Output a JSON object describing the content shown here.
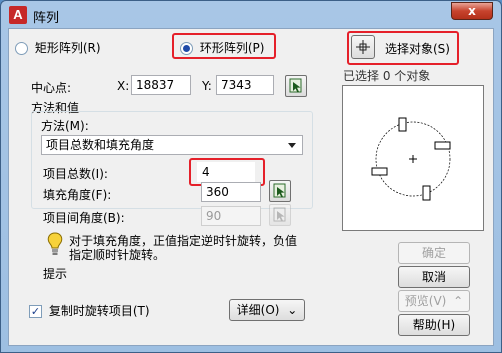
{
  "window": {
    "title": "阵列",
    "app_icon_letter": "A",
    "close_glyph": "x"
  },
  "array_type": {
    "rectangular_label": "矩形阵列(R)",
    "polar_label": "环形阵列(P)",
    "selected": "polar"
  },
  "select_objects": {
    "label": "选择对象(S)",
    "status": "已选择 0 个对象"
  },
  "center_point": {
    "label": "中心点:",
    "x_label": "X:",
    "x_value": "18837",
    "y_label": "Y:",
    "y_value": "7343"
  },
  "method_group": {
    "title": "方法和值",
    "method_label": "方法(M):",
    "method_value": "项目总数和填充角度",
    "total_items_label": "项目总数(I):",
    "total_items_value": "4",
    "fill_angle_label": "填充角度(F):",
    "fill_angle_value": "360",
    "item_angle_label": "项目间角度(B):",
    "item_angle_value": "90",
    "tip_text": "对于填充角度，正值指定逆时针旋转，负值指定顺时针旋转。",
    "tip_label": "提示"
  },
  "rotate_items": {
    "label": "复制时旋转项目(T)",
    "checked": true
  },
  "buttons": {
    "details": "详细(O)",
    "ok": "确定",
    "cancel": "取消",
    "preview": "预览(V)",
    "help": "帮助(H)"
  },
  "icons": {
    "pick_point": "pick-point-icon",
    "select_crosshair": "crosshair-icon",
    "tip_bulb": "lightbulb-icon",
    "chevron": "double-chevron-down-icon"
  }
}
